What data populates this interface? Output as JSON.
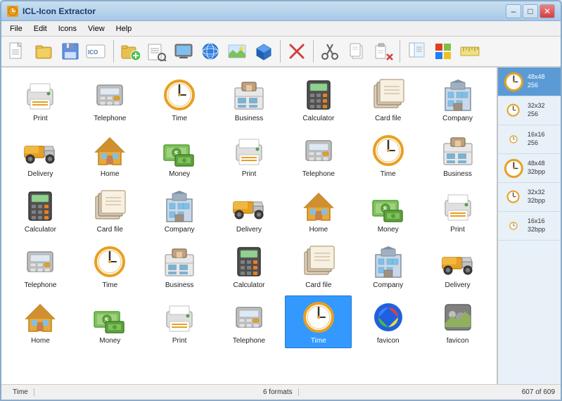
{
  "window": {
    "title": "ICL-Icon Extractor",
    "icon": "🔷"
  },
  "titlebar": {
    "buttons": {
      "minimize": "–",
      "maximize": "□",
      "close": "✕"
    }
  },
  "menu": {
    "items": [
      "File",
      "Edit",
      "Icons",
      "View",
      "Help"
    ]
  },
  "toolbar": {
    "buttons": [
      {
        "name": "new",
        "icon": "📄"
      },
      {
        "name": "open",
        "icon": "📂"
      },
      {
        "name": "save",
        "icon": "💾"
      },
      {
        "name": "ico",
        "icon": "🔷"
      },
      {
        "name": "add",
        "icon": "📁+"
      },
      {
        "name": "search-file",
        "icon": "🔍"
      },
      {
        "name": "monitor",
        "icon": "🖥"
      },
      {
        "name": "globe",
        "icon": "🌐"
      },
      {
        "name": "image",
        "icon": "🖼"
      },
      {
        "name": "box3d",
        "icon": "📦"
      },
      {
        "name": "delete-red",
        "icon": "✂"
      },
      {
        "name": "cut",
        "icon": "✂"
      },
      {
        "name": "copy",
        "icon": "📋"
      },
      {
        "name": "paste",
        "icon": "📋"
      },
      {
        "name": "delete2",
        "icon": "✕"
      },
      {
        "name": "extract",
        "icon": "📄"
      },
      {
        "name": "windows",
        "icon": "⊞"
      },
      {
        "name": "ruler",
        "icon": "📏"
      }
    ]
  },
  "icons": [
    {
      "label": "Print",
      "type": "printer"
    },
    {
      "label": "Telephone",
      "type": "telephone"
    },
    {
      "label": "Time",
      "type": "clock"
    },
    {
      "label": "Business",
      "type": "business"
    },
    {
      "label": "Calculator",
      "type": "calculator"
    },
    {
      "label": "Card file",
      "type": "cardfile"
    },
    {
      "label": "Company",
      "type": "company"
    },
    {
      "label": "Delivery",
      "type": "delivery"
    },
    {
      "label": "Home",
      "type": "home"
    },
    {
      "label": "Money",
      "type": "money"
    },
    {
      "label": "Print",
      "type": "printer"
    },
    {
      "label": "Telephone",
      "type": "telephone"
    },
    {
      "label": "Time",
      "type": "clock"
    },
    {
      "label": "Business",
      "type": "business"
    },
    {
      "label": "Calculator",
      "type": "calculator"
    },
    {
      "label": "Card file",
      "type": "cardfile"
    },
    {
      "label": "Company",
      "type": "company"
    },
    {
      "label": "Delivery",
      "type": "delivery"
    },
    {
      "label": "Home",
      "type": "home"
    },
    {
      "label": "Money",
      "type": "money"
    },
    {
      "label": "Print",
      "type": "printer"
    },
    {
      "label": "Telephone",
      "type": "telephone"
    },
    {
      "label": "Time",
      "type": "clock"
    },
    {
      "label": "Business",
      "type": "business"
    },
    {
      "label": "Calculator",
      "type": "calculator"
    },
    {
      "label": "Card file",
      "type": "cardfile"
    },
    {
      "label": "Company",
      "type": "company"
    },
    {
      "label": "Delivery",
      "type": "delivery"
    },
    {
      "label": "Home",
      "type": "home"
    },
    {
      "label": "Money",
      "type": "money"
    },
    {
      "label": "Print",
      "type": "printer"
    },
    {
      "label": "Telephone",
      "type": "telephone"
    },
    {
      "label": "Time",
      "type": "clock",
      "selected": true
    },
    {
      "label": "favicon",
      "type": "favicon1"
    },
    {
      "label": "favicon",
      "type": "favicon2"
    }
  ],
  "sizes": [
    {
      "size": "48x48",
      "depth": "256",
      "selected": true
    },
    {
      "size": "32x32",
      "depth": "256",
      "selected": false
    },
    {
      "size": "16x16",
      "depth": "256",
      "selected": false
    },
    {
      "size": "48x48",
      "depth": "32bpp",
      "selected": false
    },
    {
      "size": "32x32",
      "depth": "32bpp",
      "selected": false
    },
    {
      "size": "16x16",
      "depth": "32bpp",
      "selected": false
    }
  ],
  "statusbar": {
    "left": "Time",
    "middle": "6 formats",
    "right": "607 of 609"
  }
}
